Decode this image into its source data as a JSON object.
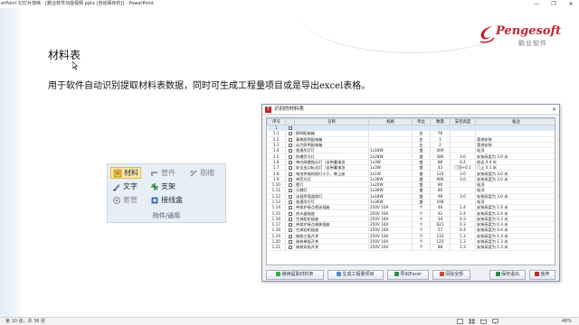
{
  "window": {
    "title": "erPoint 幻灯片放映 - [鹏业软件功能视频.pptx [自动保存的]] - PowerPoint",
    "minimize": "—",
    "restore": "❐",
    "close": "✕"
  },
  "slide": {
    "title": "材料表",
    "body": "用于软件自动识别提取材料表数据，同时可生成工程量项目或是导出excel表格。"
  },
  "logo": {
    "name": "Pengesoft",
    "subtitle": "鹏业软件"
  },
  "ribbon": {
    "items": [
      {
        "label": "材料",
        "icon": "material-icon"
      },
      {
        "label": "管件",
        "icon": "pipe-fitting-icon"
      },
      {
        "label": "剔槽",
        "icon": "groove-icon"
      },
      {
        "label": "文字",
        "icon": "text-icon"
      },
      {
        "label": "支架",
        "icon": "bracket-icon"
      },
      {
        "label": "套管",
        "icon": "sleeve-icon"
      },
      {
        "label": "接线盒",
        "icon": "junction-box-icon"
      }
    ],
    "group_label": "附件/通用"
  },
  "dialog": {
    "title": "识别的材料表",
    "columns": [
      "序号",
      "名称",
      "规格",
      "单位",
      "数量",
      "安装高度",
      "备注"
    ],
    "rows": [
      [
        "1",
        "",
        "",
        "",
        "",
        "",
        ""
      ],
      [
        "1.1",
        "照明配电箱",
        "",
        "台",
        "78",
        "",
        ""
      ],
      [
        "1.2",
        "事故照明配电箱",
        "",
        "台",
        "1",
        "",
        "落地安装"
      ],
      [
        "1.3",
        "动力照明配电箱",
        "",
        "台",
        "2",
        "",
        "落地安装"
      ],
      [
        "1.4",
        "普通吊灯灯",
        "1x18W",
        "盏",
        "409",
        "",
        "吸顶"
      ],
      [
        "1.5",
        "防爆荧光灯",
        "2x28W",
        "盏",
        "386",
        "3.0",
        "安装高度为 3.0 米"
      ],
      [
        "1.6",
        "单向疏散指示灯（自带蓄电池",
        "1x3W",
        "盏",
        "88",
        "0.4",
        "底边  0.4 米"
      ],
      [
        "1.7",
        "安全出口标志灯（自带蓄电池",
        "1x3W",
        "盏",
        "43",
        "门顶+0.1",
        "门上  0.1 米"
      ],
      [
        "1.8",
        "电池供电的照灯小于，瞬上座",
        "2x1W",
        "盏",
        "124",
        "3.0",
        "安装高度为 3.0 米"
      ],
      [
        "1.9",
        "带荧光灯",
        "1x36W",
        "盏",
        "906",
        "3.0",
        "安装高度为 3.0 米"
      ],
      [
        "1.10",
        "壁灯",
        "1x20W",
        "盏",
        "80",
        "",
        "吸顶"
      ],
      [
        "1.11",
        "天棚灯",
        "1x36W",
        "盏",
        "80",
        "",
        "吸顶"
      ],
      [
        "1.12",
        "泳鼓旁墙道照灯",
        "1x18W",
        "盏",
        "98",
        "3.0",
        "安装高度为 3.0 米"
      ],
      [
        "1.13",
        "普通吊灯灯",
        "1x36W",
        "盏",
        "198",
        "",
        "吸顶"
      ],
      [
        "1.14",
        "带保护接点密闭插座",
        "250V 10A",
        "个",
        "46",
        "1.4",
        "安装高度为 1.4 米"
      ],
      [
        "1.15",
        "热水器插座",
        "250V 16A",
        "个",
        "42",
        "2.4",
        "安装高度为 2.4 米"
      ],
      [
        "1.16",
        "空调柜机插座",
        "250V 16A",
        "个",
        "34",
        "0.3",
        "安装高度为 0.3 米"
      ],
      [
        "1.17",
        "带保护接点暗装插座",
        "250V 10A",
        "个",
        "621",
        "0.3",
        "安装高度为 0.3 米"
      ],
      [
        "1.18",
        "空调挂机插座",
        "250V 16A",
        "个",
        "57",
        "0.4",
        "安装高度为 0.4 米"
      ],
      [
        "1.19",
        "暗装三极开关",
        "250V 10A",
        "个",
        "133",
        "1.3",
        "安装高度为 1.3 米"
      ],
      [
        "1.20",
        "暗装单极开关",
        "250V 10A",
        "个",
        "125",
        "1.3",
        "安装高度为 1.3 米"
      ],
      [
        "1.21",
        "暗装双极开关",
        "250V 10A",
        "个",
        "88",
        "1.3",
        "安装高度为 1.3 米"
      ]
    ],
    "buttons": {
      "extract": "继续提取材料表",
      "generate": "生成工程量项目",
      "export": "导出Excel",
      "clear": "清除全部",
      "save_exit": "保存退出",
      "cancel": "放弃"
    }
  },
  "statusbar": {
    "pages": "第 10 张，共 36 张",
    "zoom": "48%"
  }
}
